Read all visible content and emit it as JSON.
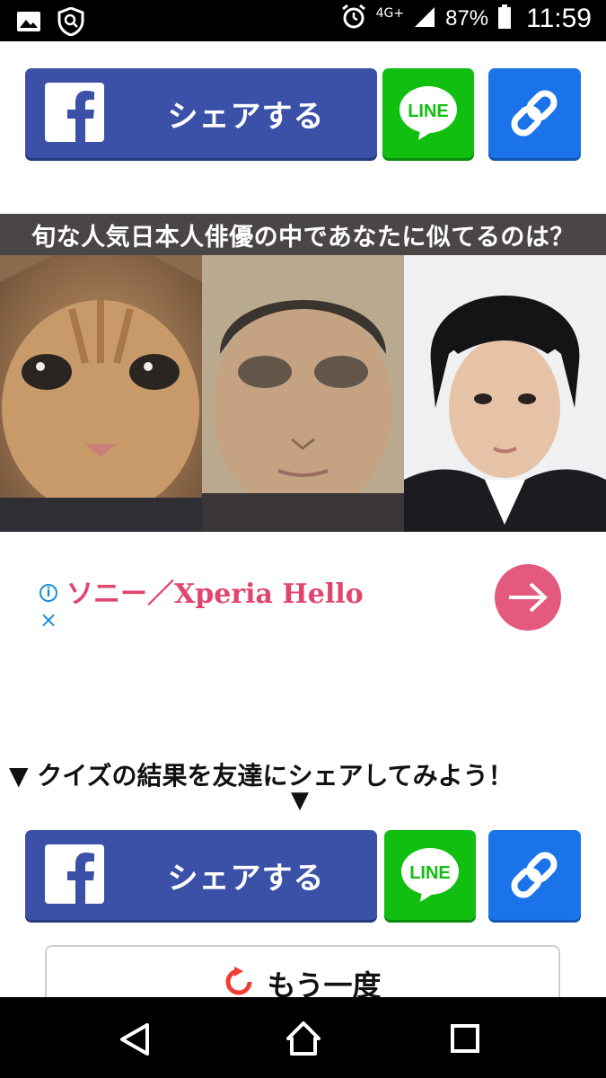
{
  "status_bar": {
    "network": "4G+",
    "battery_percent": "87%",
    "time": "11:59",
    "left_icons": [
      "image-icon",
      "shield-search-icon"
    ],
    "right_icons": [
      "alarm-icon",
      "signal-icon",
      "battery-icon"
    ]
  },
  "share_buttons": {
    "facebook_label": "シェアする",
    "line_label": "LINE",
    "link_icon": "link-icon"
  },
  "quiz": {
    "title": "旬な人気日本人俳優の中であなたに似てるのは？",
    "photos": [
      "cat-photo",
      "morphed-face-photo",
      "actor-photo"
    ]
  },
  "ad": {
    "info_icon": "i",
    "close_icon": "×",
    "text": "ソニー／Xperia Hello"
  },
  "share_prompt": {
    "text": "▼ クイズの結果を友達にシェアしてみよう！",
    "arrow": "▼"
  },
  "retry": {
    "label": "もう一度"
  },
  "navigation": [
    "back-icon",
    "home-icon",
    "recents-icon"
  ],
  "colors": {
    "facebook": "#3b51a7",
    "line": "#10bf10",
    "link": "#1a73e8",
    "ad_accent": "#e0456e"
  }
}
